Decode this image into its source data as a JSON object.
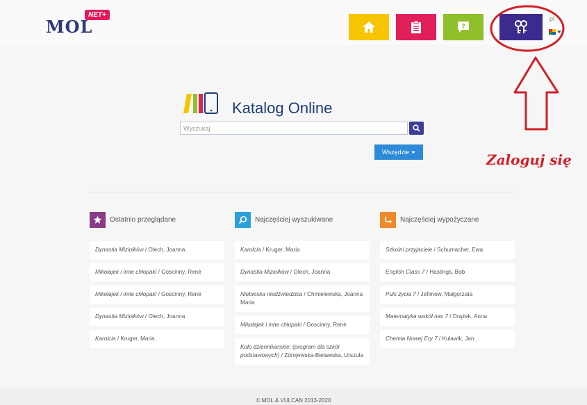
{
  "header": {
    "logo_text": "MOL",
    "logo_badge": "NET+",
    "nav": [
      {
        "name": "home-nav-button",
        "icon": "home-icon",
        "color": "#f6c500"
      },
      {
        "name": "catalog-nav-button",
        "icon": "clipboard-icon",
        "color": "#e01f5b"
      },
      {
        "name": "help-nav-button",
        "icon": "help-icon",
        "color": "#8fbf2a"
      },
      {
        "name": "login-nav-button",
        "icon": "keys-icon",
        "color": "#3c2b8c"
      }
    ],
    "lang": "pl"
  },
  "annotation": {
    "label": "Zaloguj się",
    "color": "#d21f26"
  },
  "catalog": {
    "title": "Katalog Online",
    "search_placeholder": "Wyszukaj",
    "scope_label": "Wszędzie"
  },
  "columns": [
    {
      "title": "Ostatnio przeglądane",
      "icon": "star-icon",
      "color": "#8a3b86",
      "items": [
        {
          "title": "Dynastia Miziołków",
          "author": " / Olech, Joanna"
        },
        {
          "title": "Mikołajek i inne chłopaki",
          "author": " / Goscinny, René"
        },
        {
          "title": "Mikołajek i inne chłopaki",
          "author": " / Goscinny, René"
        },
        {
          "title": "Dynastia Miziołków",
          "author": " / Olech, Joanna"
        },
        {
          "title": "Karolcia",
          "author": " / Kruger, Maria"
        }
      ]
    },
    {
      "title": "Najczęściej wyszukiwane",
      "icon": "search-icon",
      "color": "#2aa0dc",
      "items": [
        {
          "title": "Karolcia",
          "author": " / Kruger, Maria"
        },
        {
          "title": "Dynastia Miziołków",
          "author": " / Olech, Joanna"
        },
        {
          "title": "Niebieska niedźwiedzica",
          "author": " / Chmielewska, Joanna Maria"
        },
        {
          "title": "Mikołajek i inne chłopaki",
          "author": " / Goscinny, René"
        },
        {
          "title": "Koło dziennikarskie: (program dla szkół podstawowych)",
          "author": " / Zdrojewska-Bielawska, Urszula"
        }
      ]
    },
    {
      "title": "Najczęściej wypożyczane",
      "icon": "return-arrow-icon",
      "color": "#ee8a2a",
      "items": [
        {
          "title": "Szkolni przyjaciele",
          "author": " / Schumacher, Ewa"
        },
        {
          "title": "English Class 7",
          "author": " / Hastings, Bob"
        },
        {
          "title": "Puls życia 7",
          "author": " / Jefimow, Małgorzata"
        },
        {
          "title": "Matematyka wokół nas 7",
          "author": " / Drążek, Anna"
        },
        {
          "title": "Chemia Nowej Ery 7",
          "author": " / Kulawik, Jan"
        }
      ]
    }
  ],
  "footer": {
    "text": "© MOL & VULCAN 2013-2020"
  }
}
